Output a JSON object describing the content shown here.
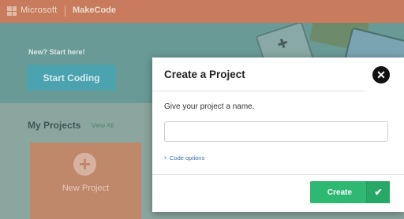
{
  "topbar": {
    "brand": "Microsoft",
    "product": "MakeCode"
  },
  "hero": {
    "new_start": "New? Start here!",
    "start_button": "Start Coding"
  },
  "projects": {
    "title": "My Projects",
    "view_all": "View All",
    "new_project": "New Project",
    "plus_icon": "+"
  },
  "modal": {
    "title": "Create a Project",
    "close_icon": "✕",
    "prompt": "Give your project a name.",
    "input_value": "",
    "input_placeholder": "",
    "code_options": "Code options",
    "code_options_icon": "›",
    "create_label": "Create",
    "create_icon": "✔"
  },
  "colors": {
    "create_green": "#2eb872",
    "overlay_teal": "#8aa69f",
    "topbar": "#c97c5d",
    "link_blue": "#3b6fa6"
  }
}
